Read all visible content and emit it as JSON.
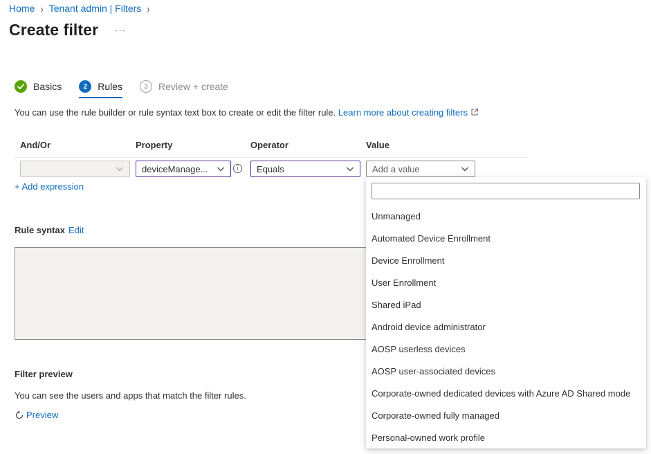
{
  "breadcrumb": [
    {
      "label": "Home"
    },
    {
      "label": "Tenant admin | Filters"
    }
  ],
  "page": {
    "title": "Create filter",
    "more_label": "···"
  },
  "steps": [
    {
      "number": "1",
      "label": "Basics",
      "state": "done"
    },
    {
      "number": "2",
      "label": "Rules",
      "state": "current"
    },
    {
      "number": "3",
      "label": "Review + create",
      "state": "future"
    }
  ],
  "intro": {
    "text": "You can use the rule builder or rule syntax text box to create or edit the filter rule.",
    "link": "Learn more about creating filters"
  },
  "rule_table": {
    "headers": {
      "and_or": "And/Or",
      "property": "Property",
      "operator": "Operator",
      "value": "Value"
    },
    "row": {
      "and_or": "",
      "property": "deviceManage...",
      "operator": "Equals",
      "value_placeholder": "Add a value"
    },
    "add_expression": "+ Add expression"
  },
  "rule_syntax": {
    "label": "Rule syntax",
    "edit": "Edit",
    "value": ""
  },
  "filter_preview": {
    "title": "Filter preview",
    "description": "You can see the users and apps that match the filter rules.",
    "preview_link": "Preview"
  },
  "value_dropdown": {
    "search_value": "",
    "options": [
      "Unmanaged",
      "Automated Device Enrollment",
      "Device Enrollment",
      "User Enrollment",
      "Shared iPad",
      "Android device administrator",
      "AOSP userless devices",
      "AOSP user-associated devices",
      "Corporate-owned dedicated devices with Azure AD Shared mode",
      "Corporate-owned fully managed",
      "Personal-owned work profile"
    ]
  },
  "colors": {
    "link": "#0f6cbd",
    "step_done": "#57a300",
    "step_current": "#0f6cbd",
    "focus_border": "#5c2e91"
  }
}
